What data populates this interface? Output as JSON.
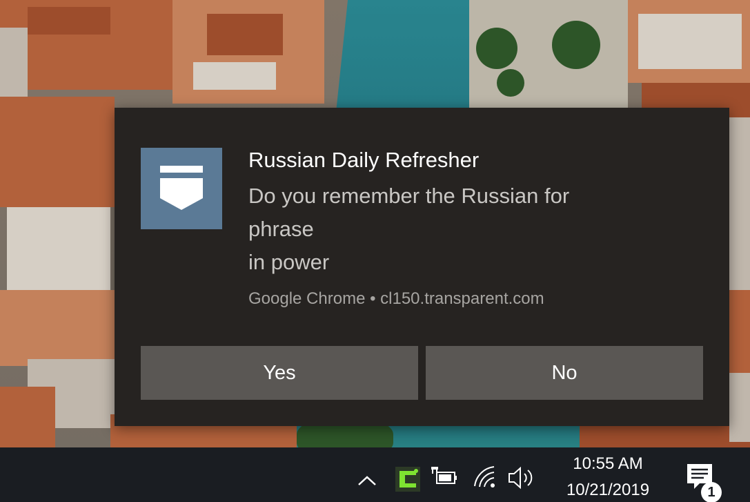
{
  "notification": {
    "app_icon": "bookmark-banner-icon",
    "title": "Russian Daily Refresher",
    "body_lines": [
      "Do you remember the Russian for",
      "phrase",
      "in power"
    ],
    "source": "Google Chrome • cl150.transparent.com",
    "actions": {
      "yes_label": "Yes",
      "no_label": "No"
    },
    "colors": {
      "background": "#262321",
      "icon_background": "#5b7a96",
      "button_background": "#5a5754"
    }
  },
  "taskbar": {
    "tray_icons": [
      "chevron-up-icon",
      "app-tray-icon",
      "battery-plug-icon",
      "wifi-icon",
      "volume-icon"
    ],
    "clock": {
      "time": "10:55 AM",
      "date": "10/21/2019"
    },
    "action_center": {
      "icon": "notification-center-icon",
      "badge_count": "1"
    }
  }
}
